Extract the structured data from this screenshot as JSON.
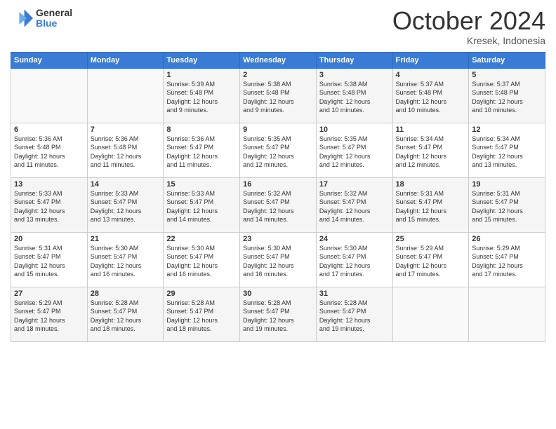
{
  "header": {
    "logo_general": "General",
    "logo_blue": "Blue",
    "month_title": "October 2024",
    "location": "Kresek, Indonesia"
  },
  "weekdays": [
    "Sunday",
    "Monday",
    "Tuesday",
    "Wednesday",
    "Thursday",
    "Friday",
    "Saturday"
  ],
  "weeks": [
    [
      {
        "day": "",
        "info": ""
      },
      {
        "day": "",
        "info": ""
      },
      {
        "day": "1",
        "info": "Sunrise: 5:39 AM\nSunset: 5:48 PM\nDaylight: 12 hours\nand 9 minutes."
      },
      {
        "day": "2",
        "info": "Sunrise: 5:38 AM\nSunset: 5:48 PM\nDaylight: 12 hours\nand 9 minutes."
      },
      {
        "day": "3",
        "info": "Sunrise: 5:38 AM\nSunset: 5:48 PM\nDaylight: 12 hours\nand 10 minutes."
      },
      {
        "day": "4",
        "info": "Sunrise: 5:37 AM\nSunset: 5:48 PM\nDaylight: 12 hours\nand 10 minutes."
      },
      {
        "day": "5",
        "info": "Sunrise: 5:37 AM\nSunset: 5:48 PM\nDaylight: 12 hours\nand 10 minutes."
      }
    ],
    [
      {
        "day": "6",
        "info": "Sunrise: 5:36 AM\nSunset: 5:48 PM\nDaylight: 12 hours\nand 11 minutes."
      },
      {
        "day": "7",
        "info": "Sunrise: 5:36 AM\nSunset: 5:48 PM\nDaylight: 12 hours\nand 11 minutes."
      },
      {
        "day": "8",
        "info": "Sunrise: 5:36 AM\nSunset: 5:47 PM\nDaylight: 12 hours\nand 11 minutes."
      },
      {
        "day": "9",
        "info": "Sunrise: 5:35 AM\nSunset: 5:47 PM\nDaylight: 12 hours\nand 12 minutes."
      },
      {
        "day": "10",
        "info": "Sunrise: 5:35 AM\nSunset: 5:47 PM\nDaylight: 12 hours\nand 12 minutes."
      },
      {
        "day": "11",
        "info": "Sunrise: 5:34 AM\nSunset: 5:47 PM\nDaylight: 12 hours\nand 12 minutes."
      },
      {
        "day": "12",
        "info": "Sunrise: 5:34 AM\nSunset: 5:47 PM\nDaylight: 12 hours\nand 13 minutes."
      }
    ],
    [
      {
        "day": "13",
        "info": "Sunrise: 5:33 AM\nSunset: 5:47 PM\nDaylight: 12 hours\nand 13 minutes."
      },
      {
        "day": "14",
        "info": "Sunrise: 5:33 AM\nSunset: 5:47 PM\nDaylight: 12 hours\nand 13 minutes."
      },
      {
        "day": "15",
        "info": "Sunrise: 5:33 AM\nSunset: 5:47 PM\nDaylight: 12 hours\nand 14 minutes."
      },
      {
        "day": "16",
        "info": "Sunrise: 5:32 AM\nSunset: 5:47 PM\nDaylight: 12 hours\nand 14 minutes."
      },
      {
        "day": "17",
        "info": "Sunrise: 5:32 AM\nSunset: 5:47 PM\nDaylight: 12 hours\nand 14 minutes."
      },
      {
        "day": "18",
        "info": "Sunrise: 5:31 AM\nSunset: 5:47 PM\nDaylight: 12 hours\nand 15 minutes."
      },
      {
        "day": "19",
        "info": "Sunrise: 5:31 AM\nSunset: 5:47 PM\nDaylight: 12 hours\nand 15 minutes."
      }
    ],
    [
      {
        "day": "20",
        "info": "Sunrise: 5:31 AM\nSunset: 5:47 PM\nDaylight: 12 hours\nand 15 minutes."
      },
      {
        "day": "21",
        "info": "Sunrise: 5:30 AM\nSunset: 5:47 PM\nDaylight: 12 hours\nand 16 minutes."
      },
      {
        "day": "22",
        "info": "Sunrise: 5:30 AM\nSunset: 5:47 PM\nDaylight: 12 hours\nand 16 minutes."
      },
      {
        "day": "23",
        "info": "Sunrise: 5:30 AM\nSunset: 5:47 PM\nDaylight: 12 hours\nand 16 minutes."
      },
      {
        "day": "24",
        "info": "Sunrise: 5:30 AM\nSunset: 5:47 PM\nDaylight: 12 hours\nand 17 minutes."
      },
      {
        "day": "25",
        "info": "Sunrise: 5:29 AM\nSunset: 5:47 PM\nDaylight: 12 hours\nand 17 minutes."
      },
      {
        "day": "26",
        "info": "Sunrise: 5:29 AM\nSunset: 5:47 PM\nDaylight: 12 hours\nand 17 minutes."
      }
    ],
    [
      {
        "day": "27",
        "info": "Sunrise: 5:29 AM\nSunset: 5:47 PM\nDaylight: 12 hours\nand 18 minutes."
      },
      {
        "day": "28",
        "info": "Sunrise: 5:28 AM\nSunset: 5:47 PM\nDaylight: 12 hours\nand 18 minutes."
      },
      {
        "day": "29",
        "info": "Sunrise: 5:28 AM\nSunset: 5:47 PM\nDaylight: 12 hours\nand 18 minutes."
      },
      {
        "day": "30",
        "info": "Sunrise: 5:28 AM\nSunset: 5:47 PM\nDaylight: 12 hours\nand 19 minutes."
      },
      {
        "day": "31",
        "info": "Sunrise: 5:28 AM\nSunset: 5:47 PM\nDaylight: 12 hours\nand 19 minutes."
      },
      {
        "day": "",
        "info": ""
      },
      {
        "day": "",
        "info": ""
      }
    ]
  ]
}
